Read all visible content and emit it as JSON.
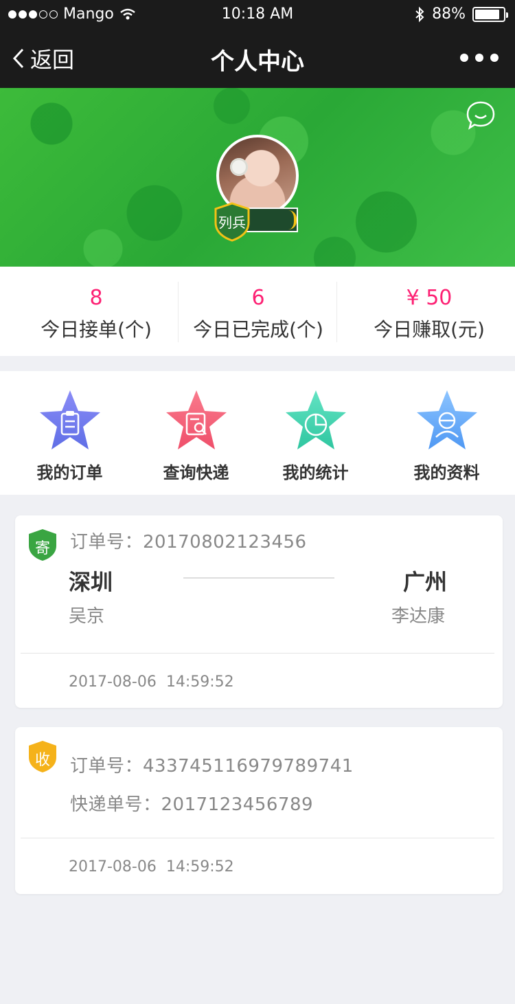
{
  "status_bar": {
    "carrier": "Mango",
    "time": "10:18 AM",
    "battery": "88%",
    "battery_level": 0.88
  },
  "nav": {
    "back_label": "返回",
    "title": "个人中心"
  },
  "profile": {
    "rank": "列兵"
  },
  "stats": [
    {
      "value": "8",
      "label": "今日接单(个)"
    },
    {
      "value": "6",
      "label": "今日已完成(个)"
    },
    {
      "value": "¥ 50",
      "label": "今日赚取(元)"
    }
  ],
  "menu": [
    {
      "label": "我的订单",
      "icon": "clipboard-icon",
      "color_top": "#8a8cf6",
      "color_bottom": "#5f6ee6"
    },
    {
      "label": "查询快递",
      "icon": "search-document-icon",
      "color_top": "#f97a8c",
      "color_bottom": "#ef4f6a"
    },
    {
      "label": "我的统计",
      "icon": "pie-chart-icon",
      "color_top": "#63e3c3",
      "color_bottom": "#2fc6a0"
    },
    {
      "label": "我的资料",
      "icon": "person-icon",
      "color_top": "#8cc4ff",
      "color_bottom": "#4f98f3"
    }
  ],
  "orders": [
    {
      "badge": "寄",
      "badge_color": "#3aa542",
      "order_label": "订单号：",
      "order_no": "20170802123456",
      "from_city": "深圳",
      "from_person": "吴京",
      "to_city": "广州",
      "to_person": "李达康",
      "date": "2017-08-06",
      "time": "14:59:52"
    },
    {
      "badge": "收",
      "badge_color": "#f5b21a",
      "order_label": "订单号：",
      "order_no": "433745116979789741",
      "express_label": "快递单号：",
      "express_no": "2017123456789",
      "date": "2017-08-06",
      "time": "14:59:52"
    }
  ],
  "colors": {
    "accent": "#fd2073",
    "text": "#333333",
    "nav_bg": "#1b1b1b",
    "hero_green": "#2aa836"
  }
}
